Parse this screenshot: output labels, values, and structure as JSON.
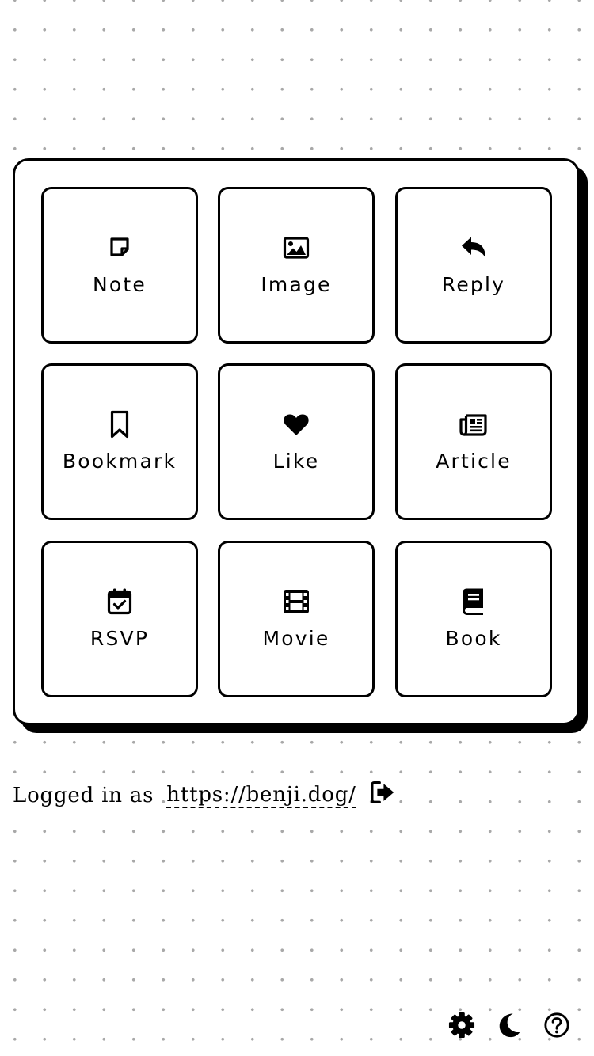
{
  "post_types": [
    {
      "label": "Note",
      "icon": "sticky-note-icon"
    },
    {
      "label": "Image",
      "icon": "image-icon"
    },
    {
      "label": "Reply",
      "icon": "reply-icon"
    },
    {
      "label": "Bookmark",
      "icon": "bookmark-icon"
    },
    {
      "label": "Like",
      "icon": "heart-icon"
    },
    {
      "label": "Article",
      "icon": "newspaper-icon"
    },
    {
      "label": "RSVP",
      "icon": "calendar-check-icon"
    },
    {
      "label": "Movie",
      "icon": "film-icon"
    },
    {
      "label": "Book",
      "icon": "book-icon"
    }
  ],
  "login": {
    "prefix": "Logged in as",
    "url": "https://benji.dog/",
    "logout_icon": "sign-out-icon"
  },
  "footer": {
    "settings_icon": "gear-icon",
    "theme_icon": "moon-icon",
    "help_icon": "question-circle-icon"
  },
  "colors": {
    "ink": "#000000",
    "background": "#ffffff",
    "dots": "#a8a8a8"
  }
}
